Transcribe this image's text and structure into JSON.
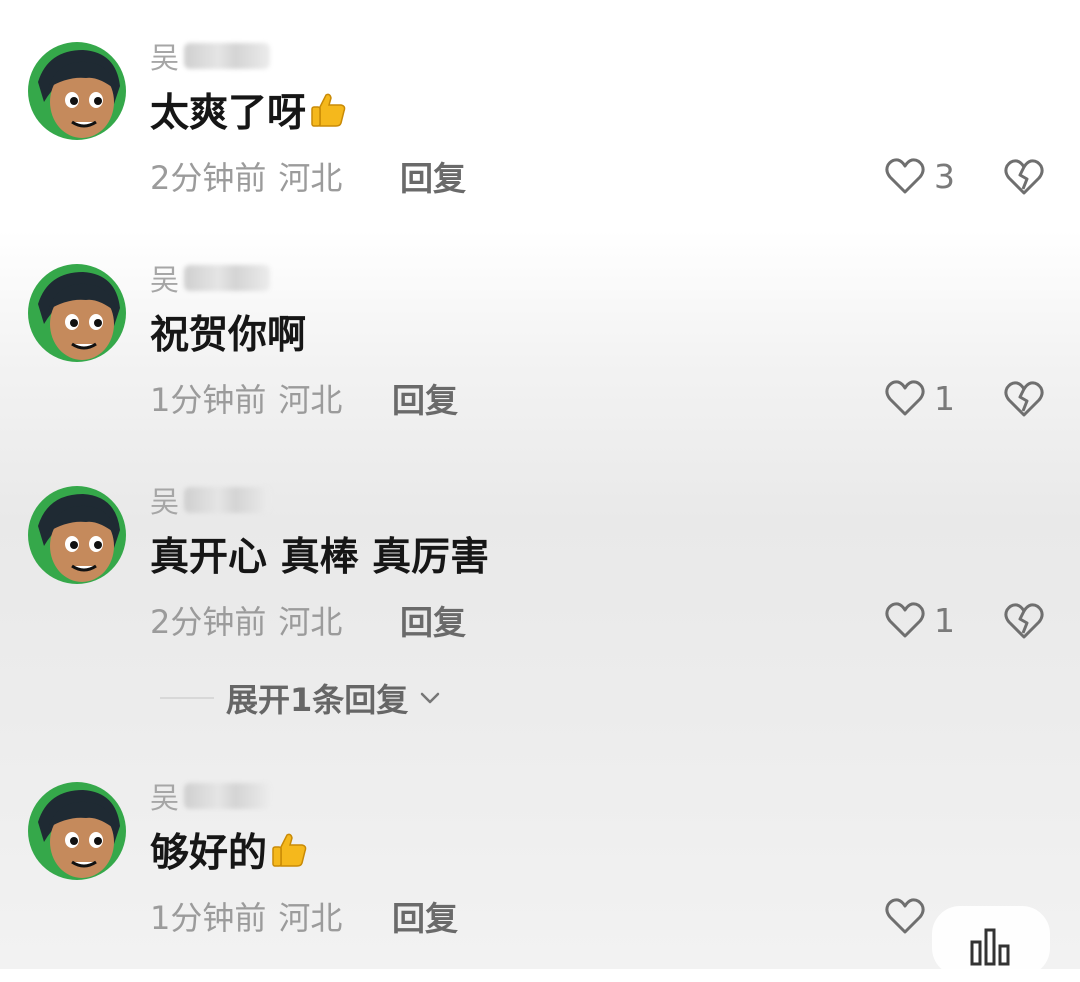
{
  "comments": [
    {
      "username_visible": "吴",
      "text": "太爽了呀",
      "emoji": "thumbs-up-icon",
      "time": "2分钟前",
      "location": "河北",
      "reply_label": "回复",
      "likes": "3"
    },
    {
      "username_visible": "吴",
      "text": "祝贺你啊",
      "emoji": "",
      "time": "1分钟前",
      "location": "河北",
      "reply_label": "回复",
      "likes": "1"
    },
    {
      "username_visible": "吴",
      "text": "真开心 真棒 真厉害",
      "emoji": "",
      "time": "2分钟前",
      "location": "河北",
      "reply_label": "回复",
      "likes": "1"
    },
    {
      "username_visible": "吴",
      "text": "够好的",
      "emoji": "thumbs-up-icon",
      "time": "1分钟前",
      "location": "河北",
      "reply_label": "回复",
      "likes": ""
    }
  ],
  "expand_replies": {
    "label": "展开1条回复"
  },
  "colors": {
    "avatar_bg": "#2e8b3a",
    "text_primary": "#161616",
    "text_secondary": "#9b9b9b"
  }
}
